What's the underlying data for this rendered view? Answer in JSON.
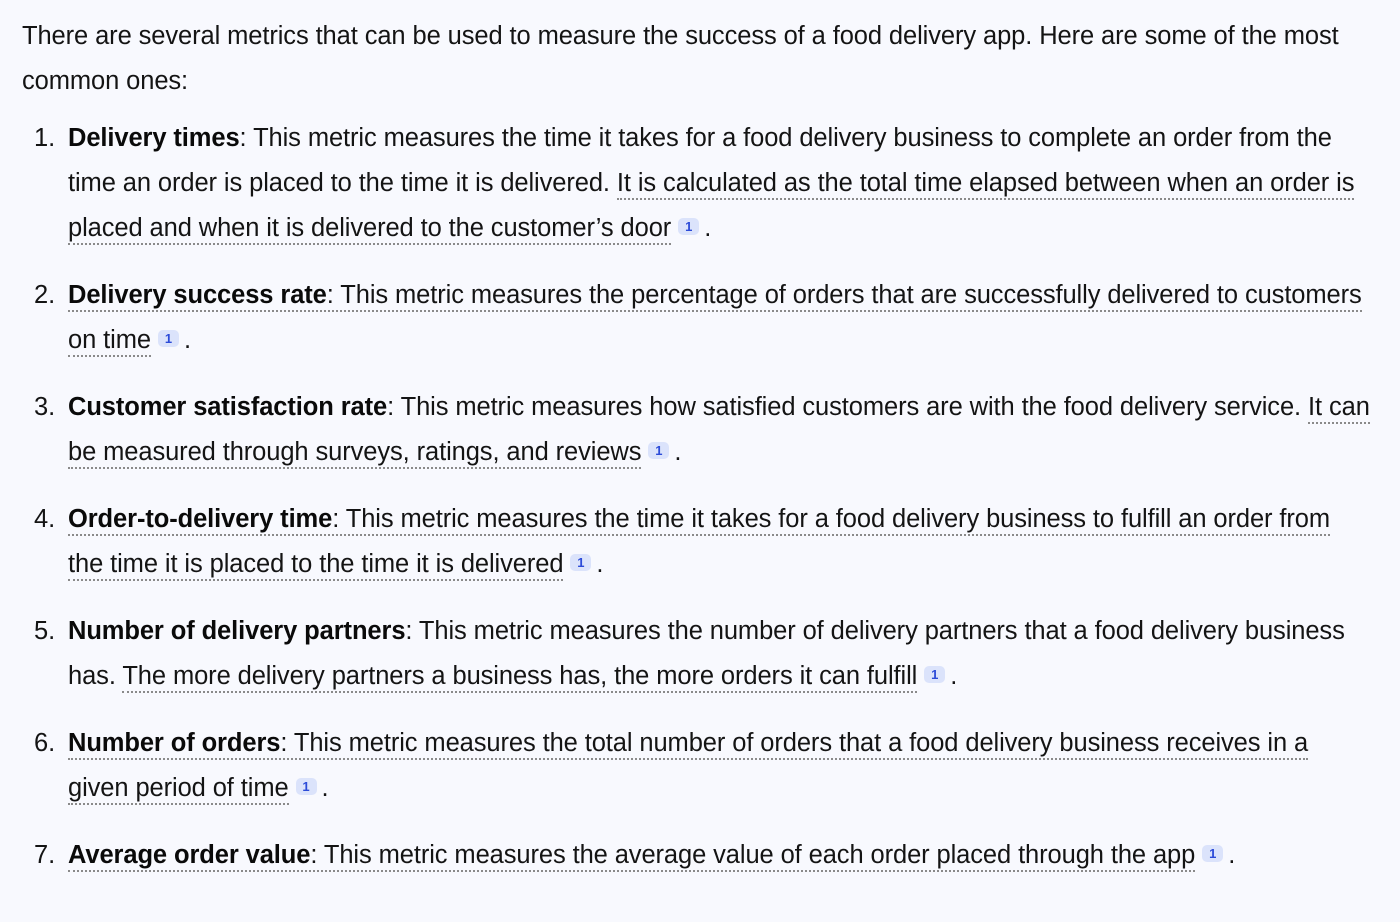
{
  "page": {
    "background_color": "#f8f9fe",
    "text_color": "#141414",
    "citation_badge_bg": "#dbe3fb",
    "citation_badge_fg": "#2c4bd8",
    "underline_color": "#8a8a8a"
  },
  "intro": "There are several metrics that can be used to measure the success of a food delivery app. Here are some of the most common ones:",
  "citation_label": "1",
  "period": ".",
  "items": [
    {
      "number": "1.",
      "term": "Delivery times",
      "separator": ": ",
      "plain": "This metric measures the time it takes for a food delivery business to complete an order from the time an order is placed to the time it is delivered. ",
      "cited": "It is calculated as the total time elapsed between when an order is placed and when it is delivered to the customer’s door",
      "citation": "1"
    },
    {
      "number": "2.",
      "term": "Delivery success rate",
      "separator": ": ",
      "plain": "",
      "cited": "This metric measures the percentage of orders that are successfully delivered to customers on time",
      "citation": "1"
    },
    {
      "number": "3.",
      "term": "Customer satisfaction rate",
      "separator": ": ",
      "plain": "This metric measures how satisfied customers are with the food delivery service. ",
      "cited": "It can be measured through surveys, ratings, and reviews",
      "citation": "1"
    },
    {
      "number": "4.",
      "term": "Order-to-delivery time",
      "separator": ": ",
      "plain": "",
      "cited": "This metric measures the time it takes for a food delivery business to fulfill an order from the time it is placed to the time it is delivered",
      "citation": "1"
    },
    {
      "number": "5.",
      "term": "Number of delivery partners",
      "separator": ": ",
      "plain": "This metric measures the number of delivery partners that a food delivery business has. ",
      "cited": "The more delivery partners a business has, the more orders it can fulfill",
      "citation": "1"
    },
    {
      "number": "6.",
      "term": "Number of orders",
      "separator": ": ",
      "plain": "",
      "cited": "This metric measures the total number of orders that a food delivery business receives in a given period of time",
      "citation": "1"
    },
    {
      "number": "7.",
      "term": "Average order value",
      "separator": ": ",
      "plain": "",
      "cited": "This metric measures the average value of each order placed through the app",
      "citation": "1"
    }
  ]
}
